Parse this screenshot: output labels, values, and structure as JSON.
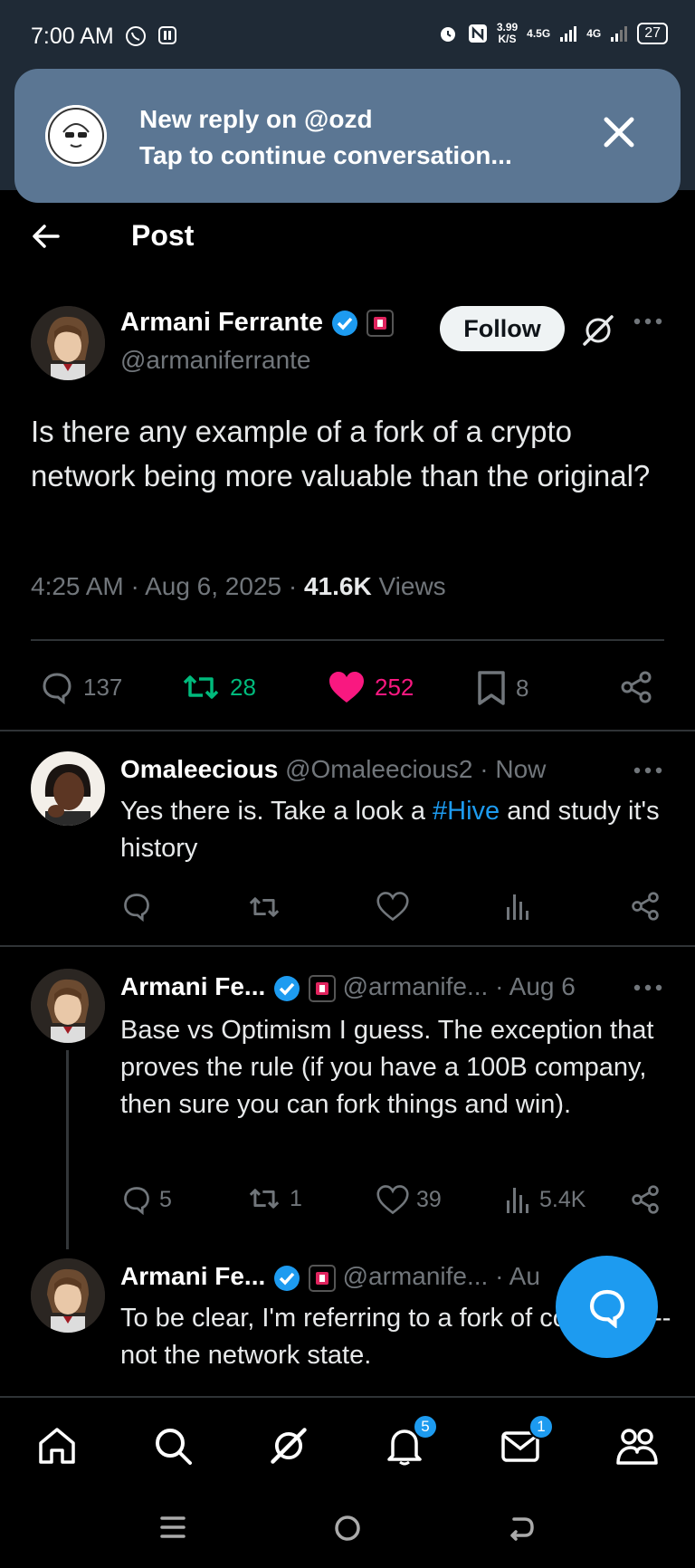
{
  "status_bar": {
    "time": "7:00 AM",
    "speed_top": "3.99",
    "speed_unit": "K/S",
    "net1": "4.5G",
    "net2": "4G",
    "battery": "27"
  },
  "notification": {
    "line1": "New reply on @ozd",
    "line2": "Tap to continue conversation..."
  },
  "header": {
    "title": "Post"
  },
  "main_post": {
    "author": "Armani Ferrante",
    "handle": "@armaniferrante",
    "follow_label": "Follow",
    "text": "Is there any example of a fork of a crypto network being more valuable than the original?",
    "time": "4:25 AM · Aug 6, 2025 · ",
    "views_count": "41.6K",
    "views_label": " Views",
    "replies": "137",
    "reposts": "28",
    "likes": "252",
    "bookmarks": "8"
  },
  "replies": [
    {
      "author": "Omaleecious",
      "handle": "@Omaleecious2",
      "time": " · Now",
      "text_before": "Yes there is. Take a look a ",
      "hashtag": "#Hive",
      "text_after": " and study it's history"
    },
    {
      "author": "Armani Fe...",
      "handle": "@armanife...",
      "time": " · Aug 6",
      "text": "Base vs Optimism I guess. The exception that proves the rule (if you have a 100B company, then sure you can fork things and win).",
      "replies": "5",
      "reposts": "1",
      "likes": "39",
      "views": "5.4K"
    },
    {
      "author": "Armani Fe...",
      "handle": "@armanife...",
      "time": " · Au",
      "text": "To be clear, I'm referring to a fork of codebase--not the network state."
    }
  ],
  "bottom_nav": {
    "notifications_badge": "5",
    "messages_badge": "1"
  },
  "colors": {
    "accent": "#1d9bf0",
    "like": "#f91880",
    "repost": "#00ba7c",
    "notification_bg": "#5b7693"
  }
}
